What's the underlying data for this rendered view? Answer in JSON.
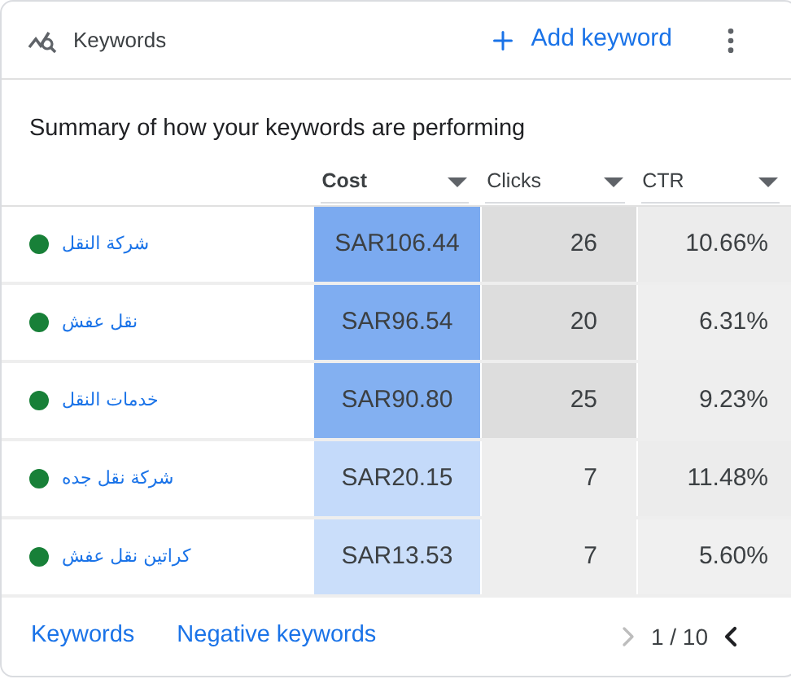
{
  "header": {
    "title": "Keywords",
    "add_button": "Add keyword"
  },
  "summary": "Summary of how your keywords are performing",
  "columns": [
    {
      "label": "Cost",
      "selected": true
    },
    {
      "label": "Clicks",
      "selected": false
    },
    {
      "label": "CTR",
      "selected": false
    }
  ],
  "rows": [
    {
      "keyword": "شركة النقل",
      "color": "#188038",
      "cells": [
        {
          "value": "SAR106.44",
          "color": "#7baaf0"
        },
        {
          "value": "26",
          "color": "#dddddd"
        },
        {
          "value": "10.66%",
          "color": "#ececec"
        }
      ]
    },
    {
      "keyword": "نقل عفش",
      "color": "#188038",
      "cells": [
        {
          "value": "SAR96.54",
          "color": "#7fadf1"
        },
        {
          "value": "20",
          "color": "#dddddd"
        },
        {
          "value": "6.31%",
          "color": "#efefef"
        }
      ]
    },
    {
      "keyword": "خدمات النقل",
      "color": "#188038",
      "cells": [
        {
          "value": "SAR90.80",
          "color": "#83b0f1"
        },
        {
          "value": "25",
          "color": "#dddddd"
        },
        {
          "value": "9.23%",
          "color": "#eeeeee"
        }
      ]
    },
    {
      "keyword": "شركة نقل جده",
      "color": "#188038",
      "cells": [
        {
          "value": "SAR20.15",
          "color": "#c4dafa"
        },
        {
          "value": "7",
          "color": "#eeeeee"
        },
        {
          "value": "11.48%",
          "color": "#ececec"
        }
      ]
    },
    {
      "keyword": "كراتين نقل عفش",
      "color": "#188038",
      "cells": [
        {
          "value": "SAR13.53",
          "color": "#cadefa"
        },
        {
          "value": "7",
          "color": "#eeeeee"
        },
        {
          "value": "5.60%",
          "color": "#f0f0f0"
        }
      ]
    }
  ],
  "footer": {
    "links": [
      "Keywords",
      "Negative keywords"
    ],
    "pager": {
      "text": "1 / 10",
      "next_disabled": true,
      "prev_disabled": false
    }
  }
}
